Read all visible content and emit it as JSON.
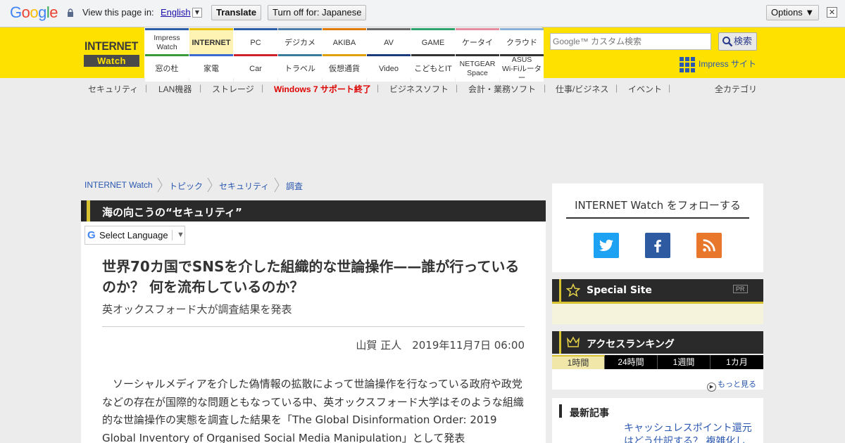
{
  "translate_bar": {
    "logo": "Google",
    "view_text": "View this page in:",
    "language": "English",
    "translate_button": "Translate",
    "turn_off_button": "Turn off for: Japanese",
    "options_button": "Options ▼",
    "close": "✕"
  },
  "header": {
    "logo_top": "INTERNET",
    "logo_bottom": "Watch",
    "nav_row1": [
      "Impress Watch",
      "INTERNET",
      "PC",
      "デジカメ",
      "AKIBA",
      "AV",
      "GAME",
      "ケータイ",
      "クラウド"
    ],
    "nav_row2": [
      "窓の杜",
      "家電",
      "Car",
      "トラベル",
      "仮想通貨",
      "Video",
      "こどもとIT",
      "NETGEAR Space",
      "ASUS Wi-Fiルーター"
    ],
    "nav_row1_colors": [
      "#2e5da8",
      "#e6c200",
      "#2e5da8",
      "#4b7ba6",
      "#e07b00",
      "#6a6a6a",
      "#2ba36a",
      "#e58ba0",
      "#8ab0d8"
    ],
    "nav_row2_colors": [
      "#3a9a3a",
      "#3a6ad1",
      "#d0202a",
      "#3a7a9a",
      "#e0a000",
      "#1a3a7a",
      "#333333",
      "#333333",
      "#333333"
    ],
    "search_placeholder": "Google™ カスタム検索",
    "search_button": "検索",
    "impress_link": "Impress サイト"
  },
  "subnav": {
    "items": [
      "セキュリティ",
      "LAN機器",
      "ストレージ",
      "Windows 7 サポート終了",
      "ビジネスソフト",
      "会計・業務ソフト",
      "仕事/ビジネス",
      "イベント"
    ],
    "all_categories": "全カテゴリ",
    "highlight_color": "#dd0000"
  },
  "breadcrumb": [
    "INTERNET Watch",
    "トピック",
    "セキュリティ",
    "調査"
  ],
  "article": {
    "category": "海の向こうの“セキュリティ”",
    "language_select": "Select Language",
    "title": "世界70カ国でSNSを介した組織的な世論操作——誰が行っているのか？ 何を流布しているのか？",
    "subtitle": "英オックスフォード大が調査結果を発表",
    "byline": "山賀 正人　2019年11月7日 06:00",
    "body": "ソーシャルメディアを介した偽情報の拡散によって世論操作を行なっている政府や政党などの存在が国際的な問題ともなっている中、英オックスフォード大学はそのような組織的な世論操作の実態を調査した結果を「The Global Disinformation Order: 2019 Global Inventory of Organised Social Media Manipulation」として発表"
  },
  "sidebar": {
    "follow_title": "INTERNET Watch をフォローする",
    "social": [
      {
        "name": "twitter",
        "color": "#1da1f2"
      },
      {
        "name": "facebook",
        "color": "#2d5aa0"
      },
      {
        "name": "rss",
        "color": "#e8772c"
      }
    ],
    "special_site": "Special Site",
    "pr": "PR",
    "ranking_title": "アクセスランキング",
    "ranking_tabs": [
      "1時間",
      "24時間",
      "1週間",
      "1カ月"
    ],
    "more": "もっと見る",
    "latest_title": "最新記事",
    "latest_item": "キャッシュレスポイント還元はどう仕訳する？ 複雑化し"
  }
}
